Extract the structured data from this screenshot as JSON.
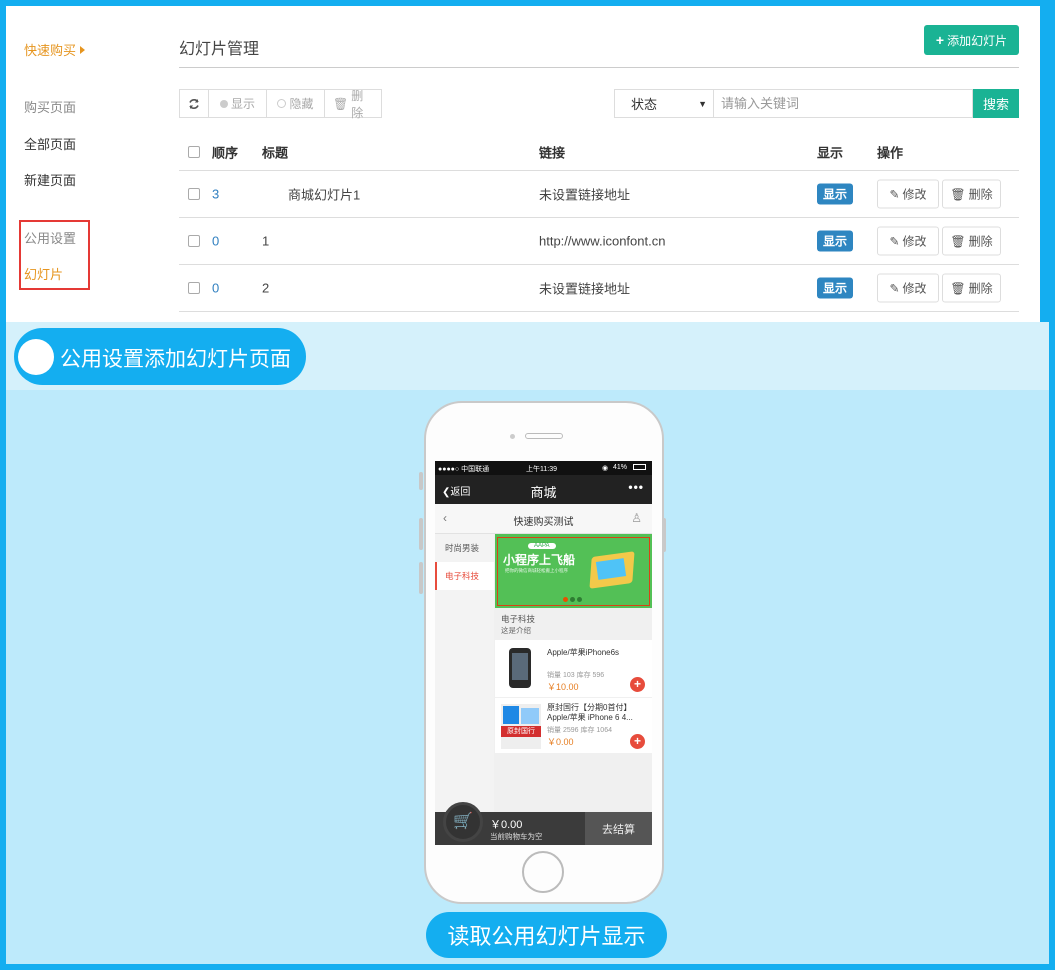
{
  "colors": {
    "outer_bg": "#14aef0",
    "accent_green": "#1ab394",
    "accent_orange": "#e6951f",
    "badge_blue": "#2e86c1",
    "highlight_red": "#e53935"
  },
  "sidebar": {
    "quick_buy": "快速购买",
    "buy_page": "购买页面",
    "all_pages": "全部页面",
    "new_page": "新建页面",
    "common_settings": "公用设置",
    "slides": "幻灯片"
  },
  "header": {
    "title": "幻灯片管理",
    "add_button": "添加幻灯片"
  },
  "toolbar": {
    "show": "显示",
    "hide": "隐藏",
    "delete": "删除"
  },
  "filter": {
    "status_value": "状态",
    "search_placeholder": "请输入关键词",
    "search_button": "搜索"
  },
  "table": {
    "headers": {
      "order": "顺序",
      "title": "标题",
      "link": "链接",
      "show": "显示",
      "ops": "操作"
    },
    "rows": [
      {
        "order": "3",
        "title": "商城幻灯片1",
        "link": "未设置链接地址",
        "status": "显示"
      },
      {
        "order": "0",
        "title": "1",
        "link": "http://www.iconfont.cn",
        "status": "显示"
      },
      {
        "order": "0",
        "title": "2",
        "link": "未设置链接地址",
        "status": "显示"
      }
    ],
    "edit_label": "修改",
    "delete_label": "删除"
  },
  "captions": {
    "top": "公用设置添加幻灯片页面",
    "bottom": "读取公用幻灯片显示"
  },
  "phone": {
    "carrier": "●●●●○ 中国联通",
    "time": "上午11:39",
    "battery": "41%",
    "back": "返回",
    "nav_title": "商城",
    "page_title": "快速购买测试",
    "categories": [
      "时尚男装",
      "电子科技"
    ],
    "banner_tag": "AAPA",
    "banner_title": "小程序上飞船",
    "banner_sub": "把你的微信商城轻松搬上小程序",
    "section_title": "电子科技",
    "section_sub": "这是介绍",
    "products": [
      {
        "name": "Apple/苹果iPhone6s",
        "meta": "销量 103 库存 596",
        "price": "￥10.00"
      },
      {
        "name": "原封国行【分期0首付】Apple/苹果 iPhone 6 4...",
        "meta": "销量 2596 库存 1064",
        "price": "￥0.00",
        "badge": "原封国行"
      }
    ],
    "cart_price": "￥0.00",
    "cart_empty": "当前购物车为空",
    "checkout": "去结算"
  }
}
